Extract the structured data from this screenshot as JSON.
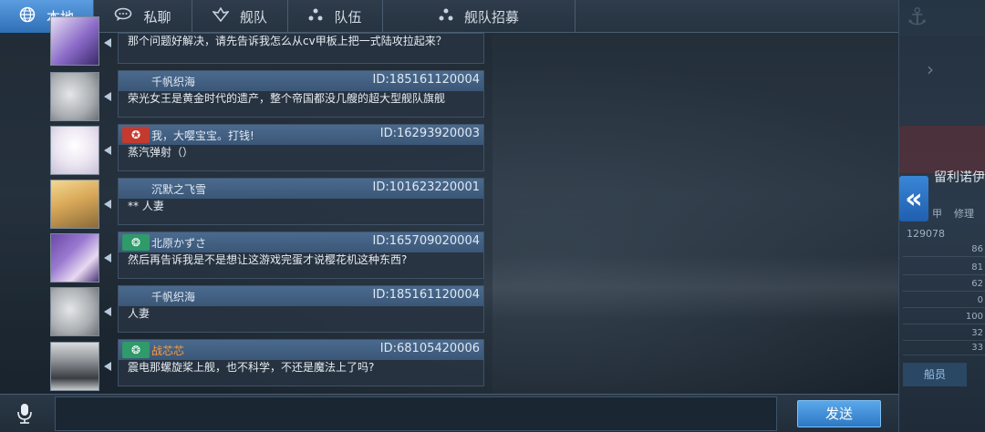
{
  "tabs": [
    {
      "label": "本地",
      "icon": "globe-icon",
      "active": true
    },
    {
      "label": "私聊",
      "icon": "speech-bubble-icon",
      "active": false
    },
    {
      "label": "舰队",
      "icon": "fleet-emblem-icon",
      "active": false
    },
    {
      "label": "队伍",
      "icon": "team-dots-icon",
      "active": false
    },
    {
      "label": "舰队招募",
      "icon": "recruit-dots-icon",
      "active": false
    }
  ],
  "messages": [
    {
      "sender": "",
      "uid": "",
      "badge": "",
      "badge_color": "",
      "sender_color": "",
      "text": "那个问题好解决，请先告诉我怎么从cv甲板上把一式陆攻拉起来？",
      "avatar_color": "#8a6ac8"
    },
    {
      "sender": "千帆织海",
      "uid": "ID:185161120004",
      "badge": "",
      "badge_color": "",
      "sender_color": "",
      "text": "荣光女王是黄金时代的遗产，整个帝国都没几艘的超大型舰队旗舰",
      "avatar_color": "#b8bcc0"
    },
    {
      "sender": "我，大嘤宝宝。打钱!",
      "uid": "ID:16293920003",
      "badge": "emblem",
      "badge_color": "#c43a2e",
      "sender_color": "",
      "text": "蒸汽弹射（）",
      "avatar_color": "#e8e4f0"
    },
    {
      "sender": "沉默之飞雪",
      "uid": "ID:101623220001",
      "badge": "",
      "badge_color": "",
      "sender_color": "",
      "text": "** 人妻",
      "avatar_color": "#d8b070"
    },
    {
      "sender": "北原かずさ",
      "uid": "ID:165709020004",
      "badge": "emblem",
      "badge_color": "#2f9a6a",
      "sender_color": "",
      "text": "然后再告诉我是不是想让这游戏完蛋才说樱花机这种东西?",
      "avatar_color": "#7a58b8"
    },
    {
      "sender": "千帆织海",
      "uid": "ID:185161120004",
      "badge": "",
      "badge_color": "",
      "sender_color": "",
      "text": "人妻",
      "avatar_color": "#b8bcc0"
    },
    {
      "sender": "战芯芯",
      "uid": "ID:68105420006",
      "badge": "emblem",
      "badge_color": "#2f9a6a",
      "sender_color": "#ff9a3a",
      "text": "震电那螺旋桨上舰，也不科学，不还是魔法上了吗?",
      "avatar_color": "#9aa0a6"
    }
  ],
  "input": {
    "value": "",
    "placeholder": ""
  },
  "send_label": "发送",
  "right_panel": {
    "name_fragment": "留利诺伊",
    "label_a": "甲",
    "label_b": "修理",
    "number": "129078",
    "stats": [
      "86",
      "81",
      "62",
      "0",
      "100",
      "32",
      "33"
    ],
    "member_label": "船员"
  }
}
